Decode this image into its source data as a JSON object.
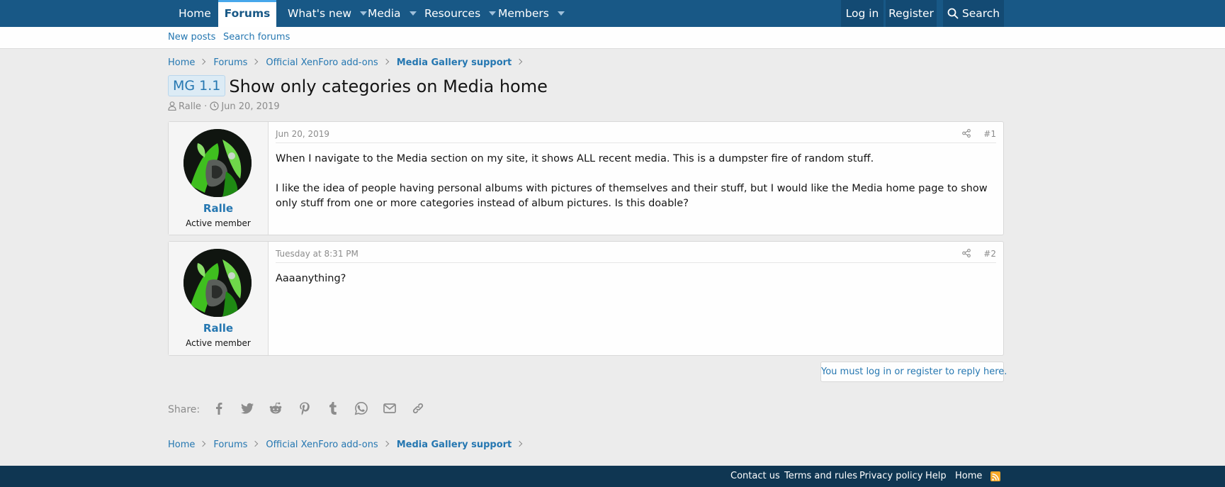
{
  "nav": {
    "home": "Home",
    "forums": "Forums",
    "whats_new": "What's new",
    "media": "Media",
    "resources": "Resources",
    "members": "Members",
    "login": "Log in",
    "register": "Register",
    "search": "Search"
  },
  "subnav": {
    "new_posts": "New posts",
    "search_forums": "Search forums"
  },
  "breadcrumbs": [
    "Home",
    "Forums",
    "Official XenForo add-ons",
    "Media Gallery support"
  ],
  "thread": {
    "prefix": "MG 1.1",
    "title": "Show only categories on Media home",
    "author": "Ralle",
    "date": "Jun 20, 2019"
  },
  "posts": [
    {
      "username": "Ralle",
      "user_title": "Active member",
      "date": "Jun 20, 2019",
      "number": "#1",
      "paragraphs": [
        "When I navigate to the Media section on my site, it shows ALL recent media. This is a dumpster fire of random stuff.",
        "I like the idea of people having personal albums with pictures of themselves and their stuff, but I would like the Media home page to show only stuff from one or more categories instead of album pictures. Is this doable?"
      ]
    },
    {
      "username": "Ralle",
      "user_title": "Active member",
      "date": "Tuesday at 8:31 PM",
      "number": "#2",
      "paragraphs": [
        "Aaaanything?"
      ]
    }
  ],
  "reply_notice": "You must log in or register to reply here.",
  "share": {
    "label": "Share:",
    "icons": [
      "facebook-icon",
      "twitter-icon",
      "reddit-icon",
      "pinterest-icon",
      "tumblr-icon",
      "whatsapp-icon",
      "email-icon",
      "link-icon"
    ]
  },
  "footer": {
    "contact": "Contact us",
    "terms": "Terms and rules",
    "privacy": "Privacy policy",
    "help": "Help",
    "home": "Home"
  },
  "colors": {
    "nav_bg": "#185886",
    "link": "#2577b1",
    "footer_bg": "#0f3652",
    "page_bg": "#ececec"
  }
}
